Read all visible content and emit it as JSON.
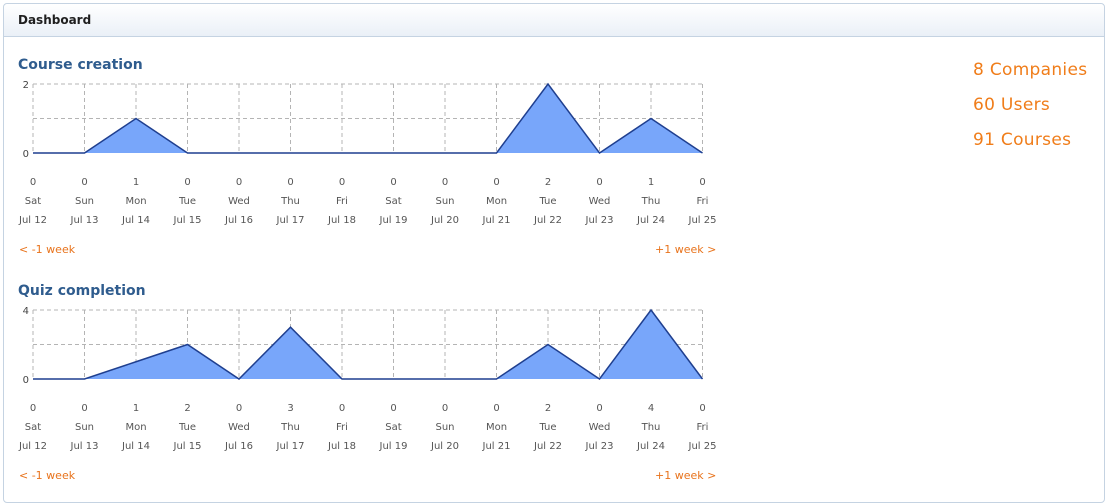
{
  "header": {
    "title": "Dashboard"
  },
  "stats": [
    "8 Companies",
    "60 Users",
    "91 Courses"
  ],
  "nav": {
    "prev": "< -1 week",
    "next": "+1 week >"
  },
  "days": [
    "Sat",
    "Sun",
    "Mon",
    "Tue",
    "Wed",
    "Thu",
    "Fri",
    "Sat",
    "Sun",
    "Mon",
    "Tue",
    "Wed",
    "Thu",
    "Fri"
  ],
  "dates": [
    "Jul 12",
    "Jul 13",
    "Jul 14",
    "Jul 15",
    "Jul 16",
    "Jul 17",
    "Jul 18",
    "Jul 19",
    "Jul 20",
    "Jul 21",
    "Jul 22",
    "Jul 23",
    "Jul 24",
    "Jul 25"
  ],
  "colors": {
    "fill": "#78a6fa",
    "line": "#1f3f8f",
    "title": "#2f5c8e",
    "accent": "#f07d1a"
  },
  "chart_data": [
    {
      "type": "area",
      "title": "Course creation",
      "categories": [
        "Jul 12",
        "Jul 13",
        "Jul 14",
        "Jul 15",
        "Jul 16",
        "Jul 17",
        "Jul 18",
        "Jul 19",
        "Jul 20",
        "Jul 21",
        "Jul 22",
        "Jul 23",
        "Jul 24",
        "Jul 25"
      ],
      "values": [
        0,
        0,
        1,
        0,
        0,
        0,
        0,
        0,
        0,
        0,
        2,
        0,
        1,
        0
      ],
      "yticks": [
        "0",
        "2"
      ],
      "ylim": [
        0,
        2
      ],
      "grid": true
    },
    {
      "type": "area",
      "title": "Quiz completion",
      "categories": [
        "Jul 12",
        "Jul 13",
        "Jul 14",
        "Jul 15",
        "Jul 16",
        "Jul 17",
        "Jul 18",
        "Jul 19",
        "Jul 20",
        "Jul 21",
        "Jul 22",
        "Jul 23",
        "Jul 24",
        "Jul 25"
      ],
      "values": [
        0,
        0,
        1,
        2,
        0,
        3,
        0,
        0,
        0,
        0,
        2,
        0,
        4,
        0
      ],
      "yticks": [
        "0",
        "4"
      ],
      "ylim": [
        0,
        4
      ],
      "grid": true
    }
  ]
}
